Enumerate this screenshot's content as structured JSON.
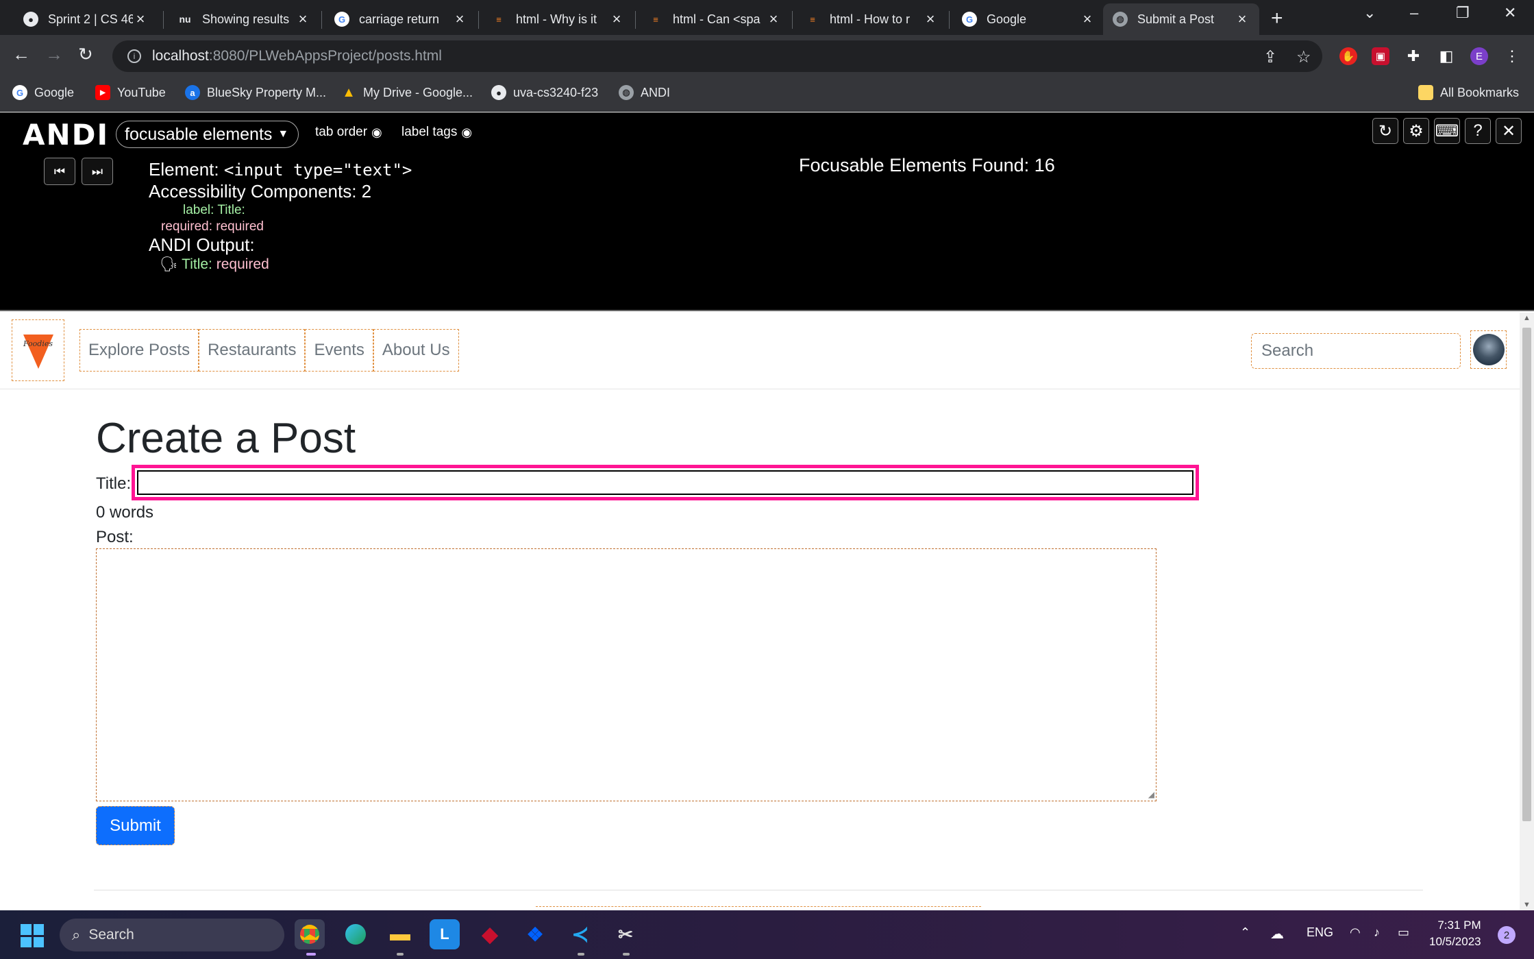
{
  "browser": {
    "tabs": [
      {
        "title": "Sprint 2 | CS 46",
        "icon": "github-icon"
      },
      {
        "title": "Showing results",
        "icon": "nu-icon"
      },
      {
        "title": "carriage return",
        "icon": "google-icon"
      },
      {
        "title": "html - Why is it",
        "icon": "stackoverflow-icon"
      },
      {
        "title": "html - Can <spa",
        "icon": "stackoverflow-icon"
      },
      {
        "title": "html - How to r",
        "icon": "stackoverflow-icon"
      },
      {
        "title": "Google",
        "icon": "google-icon"
      },
      {
        "title": "Submit a Post",
        "icon": "globe-icon",
        "active": true
      }
    ],
    "url_host": "localhost",
    "url_path": ":8080/PLWebAppsProject/posts.html",
    "profile_initial": "E",
    "bookmarks": [
      {
        "label": "Google",
        "icon": "google-icon"
      },
      {
        "label": "YouTube",
        "icon": "youtube-icon"
      },
      {
        "label": "BlueSky Property M...",
        "icon": "bluesky-icon"
      },
      {
        "label": "My Drive - Google...",
        "icon": "drive-icon"
      },
      {
        "label": "uva-cs3240-f23",
        "icon": "github-icon"
      },
      {
        "label": "ANDI",
        "icon": "globe-icon"
      }
    ],
    "all_bookmarks": "All Bookmarks"
  },
  "andi": {
    "logo": "ANDI",
    "mode": "focusable elements",
    "tab_order": "tab order",
    "label_tags": "label tags",
    "element_label": "Element:",
    "element_value": "<input type=\"text\">",
    "components": "Accessibility Components: 2",
    "label_key": "label:",
    "label_value": "Title:",
    "required_key": "required:",
    "required_value": "required",
    "output_heading": "ANDI Output:",
    "output_title": "Title:",
    "output_required": "required",
    "found": "Focusable Elements Found: 16"
  },
  "site": {
    "logo_text": "Foodies",
    "nav": [
      "Explore Posts",
      "Restaurants",
      "Events",
      "About Us"
    ],
    "search_placeholder": "Search"
  },
  "form": {
    "heading": "Create a Post",
    "title_label": "Title:",
    "word_count": "0 words",
    "post_label": "Post:",
    "submit": "Submit"
  },
  "taskbar": {
    "search": "Search",
    "lang": "ENG",
    "time": "7:31 PM",
    "date": "10/5/2023",
    "notifications": "2"
  },
  "colors": {
    "andi_highlight": "#ff1493",
    "submit_blue": "#0d6efd",
    "logo_orange": "#f25f1f"
  }
}
